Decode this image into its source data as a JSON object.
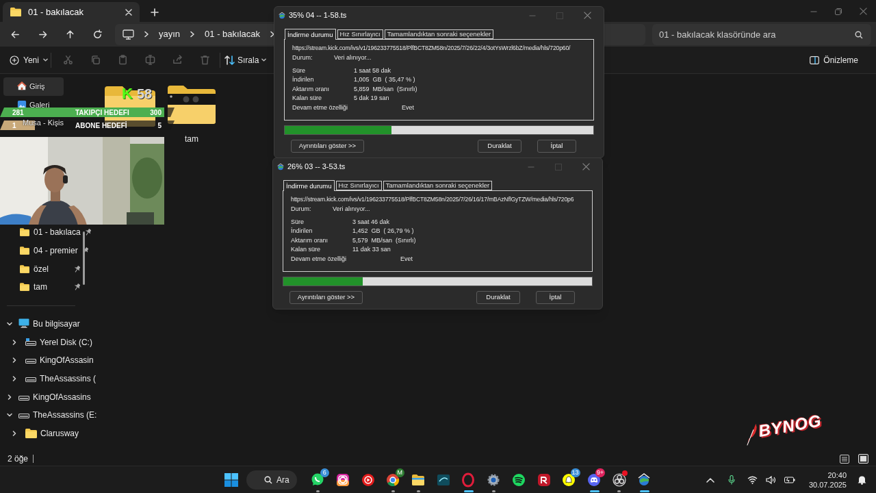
{
  "explorer": {
    "tab_title": "01 - bakılacak",
    "breadcrumb": [
      "yayın",
      "01 - bakılacak"
    ],
    "search": {
      "placeholder": "01 - bakılacak klasöründe ara"
    },
    "toolbar": {
      "new": "Yeni",
      "sort": "Sırala",
      "preview": "Önizleme"
    },
    "sidebar": {
      "quick_access": [
        {
          "label": "Giriş",
          "kind": "home",
          "selected": true
        },
        {
          "label": "Galeri",
          "kind": "gallery",
          "selected": false
        },
        {
          "label": "Musa - Kişis",
          "selected": false
        }
      ],
      "pinned": [
        {
          "label": "01 - bakılaca",
          "selected": false
        },
        {
          "label": "04 - premier",
          "selected": false
        },
        {
          "label": "özel",
          "selected": false
        },
        {
          "label": "tam",
          "selected": false
        }
      ],
      "tree": [
        {
          "label": "Bu bilgisayar",
          "kind": "computer",
          "expanded": true,
          "children": [
            {
              "label": "Yerel Disk (C:)",
              "kind": "system-drive",
              "expanded": false
            },
            {
              "label": "KingOfAssasin",
              "kind": "drive",
              "expanded": false
            },
            {
              "label": "TheAssassins (",
              "kind": "drive",
              "expanded": false
            }
          ]
        },
        {
          "label": "KingOfAssasins",
          "kind": "drive",
          "expanded": false
        },
        {
          "label": "TheAssassins (E:",
          "kind": "drive",
          "expanded": true,
          "children": [
            {
              "label": "Clarusway",
              "kind": "folder",
              "expanded": false
            }
          ]
        }
      ]
    },
    "files": [
      {
        "kind": "folder"
      },
      {
        "kind": "folder-thumbnail",
        "label": "tam"
      }
    ],
    "status_bar": "2 öğe"
  },
  "stream_overlay": {
    "goals": [
      {
        "current": "281",
        "label": "TAKIPÇI HEDEFI",
        "target": "300",
        "level": 0.94,
        "color": "#4caf50"
      },
      {
        "current": "1",
        "label": "ABONE HEDEFİ",
        "target": "5",
        "level": 0.2,
        "color": "#c8a97a"
      }
    ],
    "viewers": {
      "logo": "K",
      "count": "58"
    },
    "logo": "BYNOG"
  },
  "dialogs": [
    {
      "title": "35% 04 -- 1-58.ts",
      "tabs": [
        {
          "label": "İndirme durumu",
          "selected": true
        },
        {
          "label": "Hız Sınırlayıcı",
          "selected": false
        },
        {
          "label": "Tamamlandıktan sonraki seçenekler",
          "selected": false
        }
      ],
      "url": "https://stream.kick.com/ivs/v1/196233775518/PlfBCT8ZM58n/2025/7/26/22/4/3otYsWrzl6bZ/media/hls/720p60/",
      "status": {
        "label": "Durum:",
        "value": "Veri alınıyor..."
      },
      "details": [
        {
          "label": "Süre",
          "value": "1 saat 58 dak"
        },
        {
          "label": "İndirilen",
          "value": "1,005  GB  ( 35,47 % )"
        },
        {
          "label": "Aktarım oranı",
          "value": "5,859  MB/san  (Sınırlı)"
        },
        {
          "label": "Kalan süre",
          "value": "5 dak 19 san"
        }
      ],
      "resume": {
        "label": "Devam etme özelliği",
        "value": "Evet"
      },
      "level": 0.347,
      "buttons": [
        "Ayrıntıları göster >>",
        "Duraklat",
        "İptal"
      ]
    },
    {
      "title": "26% 03 -- 3-53.ts",
      "tabs": [
        {
          "label": "İndirme durumu",
          "selected": true
        },
        {
          "label": "Hız Sınırlayıcı",
          "selected": false
        },
        {
          "label": "Tamamlandıktan sonraki seçenekler",
          "selected": false
        }
      ],
      "url": "https://stream.kick.com/ivs/v1/196233775518/PlfBCT8ZM58n/2025/7/26/16/17/mBAzNflGyTZW/media/hls/720p6",
      "status": {
        "label": "Durum:",
        "value": "Veri alınıyor..."
      },
      "details": [
        {
          "label": "Süre",
          "value": "3 saat 46 dak"
        },
        {
          "label": "İndirilen",
          "value": "1,452  GB  ( 26,79 % )"
        },
        {
          "label": "Aktarım oranı",
          "value": "5,579  MB/san  (Sınırlı)"
        },
        {
          "label": "Kalan süre",
          "value": "11 dak 33 san"
        }
      ],
      "resume": {
        "label": "Devam etme özelliği",
        "value": "Evet"
      },
      "level": 0.258,
      "buttons": [
        "Ayrıntıları göster >>",
        "Duraklat",
        "İptal"
      ]
    }
  ],
  "taskbar": {
    "search": "Ara",
    "apps": [
      {
        "kind": "chat",
        "badge": "6",
        "running": true,
        "active": false,
        "alert": false
      },
      {
        "kind": "camera",
        "running": false,
        "active": false,
        "alert": false
      },
      {
        "kind": "play",
        "running": false,
        "active": false,
        "alert": false
      },
      {
        "kind": "browser",
        "badge": "M",
        "running": true,
        "active": false,
        "alert": false
      },
      {
        "kind": "folder",
        "running": true,
        "active": false,
        "alert": false
      },
      {
        "kind": "tv",
        "running": false,
        "active": false,
        "alert": false
      },
      {
        "kind": "ring",
        "running": true,
        "active": true,
        "alert": false
      },
      {
        "kind": "gear",
        "running": true,
        "active": false,
        "alert": false
      },
      {
        "kind": "waves",
        "running": false,
        "active": false,
        "alert": false
      },
      {
        "kind": "red-app",
        "running": false,
        "active": false,
        "alert": false
      },
      {
        "kind": "ghost",
        "badge": "13",
        "running": false,
        "active": false,
        "alert": false
      },
      {
        "kind": "controller",
        "badge": "9+",
        "running": true,
        "active": true,
        "alert": false
      },
      {
        "kind": "record",
        "running": true,
        "active": false,
        "alert": true
      },
      {
        "kind": "globe",
        "running": true,
        "active": true,
        "alert": false
      }
    ],
    "time": "20:40",
    "date": "30.07.2025"
  }
}
